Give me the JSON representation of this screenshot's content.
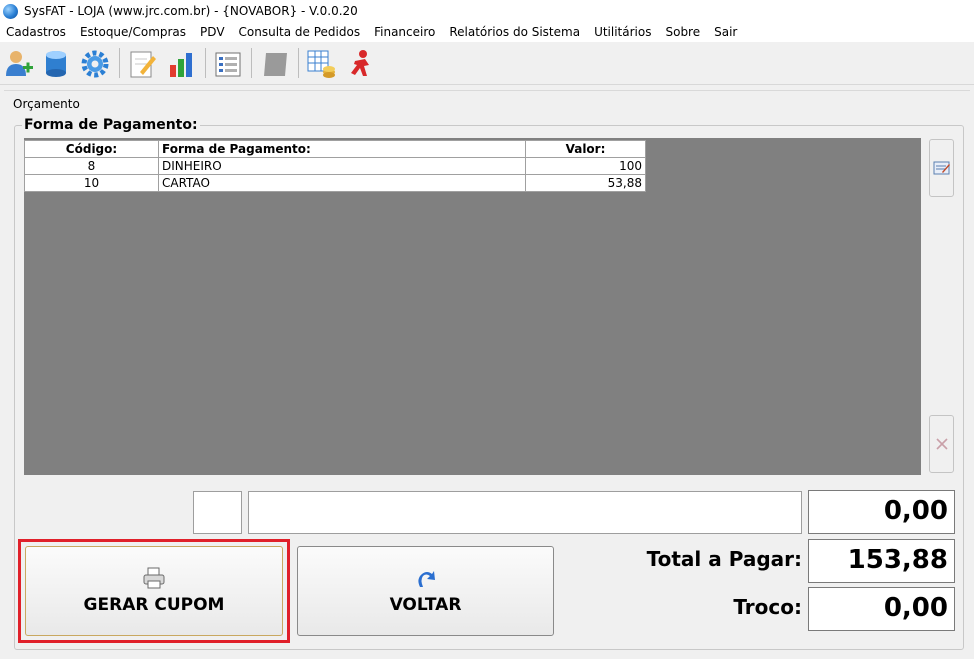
{
  "window": {
    "title": "SysFAT - LOJA (www.jrc.com.br) - {NOVABOR} - V.0.0.20"
  },
  "menu": [
    "Cadastros",
    "Estoque/Compras",
    "PDV",
    "Consulta de Pedidos",
    "Financeiro",
    "Relatórios do Sistema",
    "Utilitários",
    "Sobre",
    "Sair"
  ],
  "panel": {
    "label": "Orçamento",
    "group_title": "Forma de Pagamento:"
  },
  "grid": {
    "headers": [
      "Código:",
      "Forma de Pagamento:",
      "Valor:"
    ],
    "rows": [
      {
        "codigo": "8",
        "forma": "DINHEIRO",
        "valor": "100"
      },
      {
        "codigo": "10",
        "forma": "CARTAO",
        "valor": "53,88"
      }
    ]
  },
  "entry": {
    "amount": "0,00"
  },
  "totals": {
    "total_label": "Total a Pagar:",
    "total_value": "153,88",
    "troco_label": "Troco:",
    "troco_value": "0,00"
  },
  "buttons": {
    "gerar_cupom": "GERAR CUPOM",
    "voltar": "VOLTAR"
  },
  "colors": {
    "grid_background": "#808080",
    "highlight": "#e0202a"
  }
}
